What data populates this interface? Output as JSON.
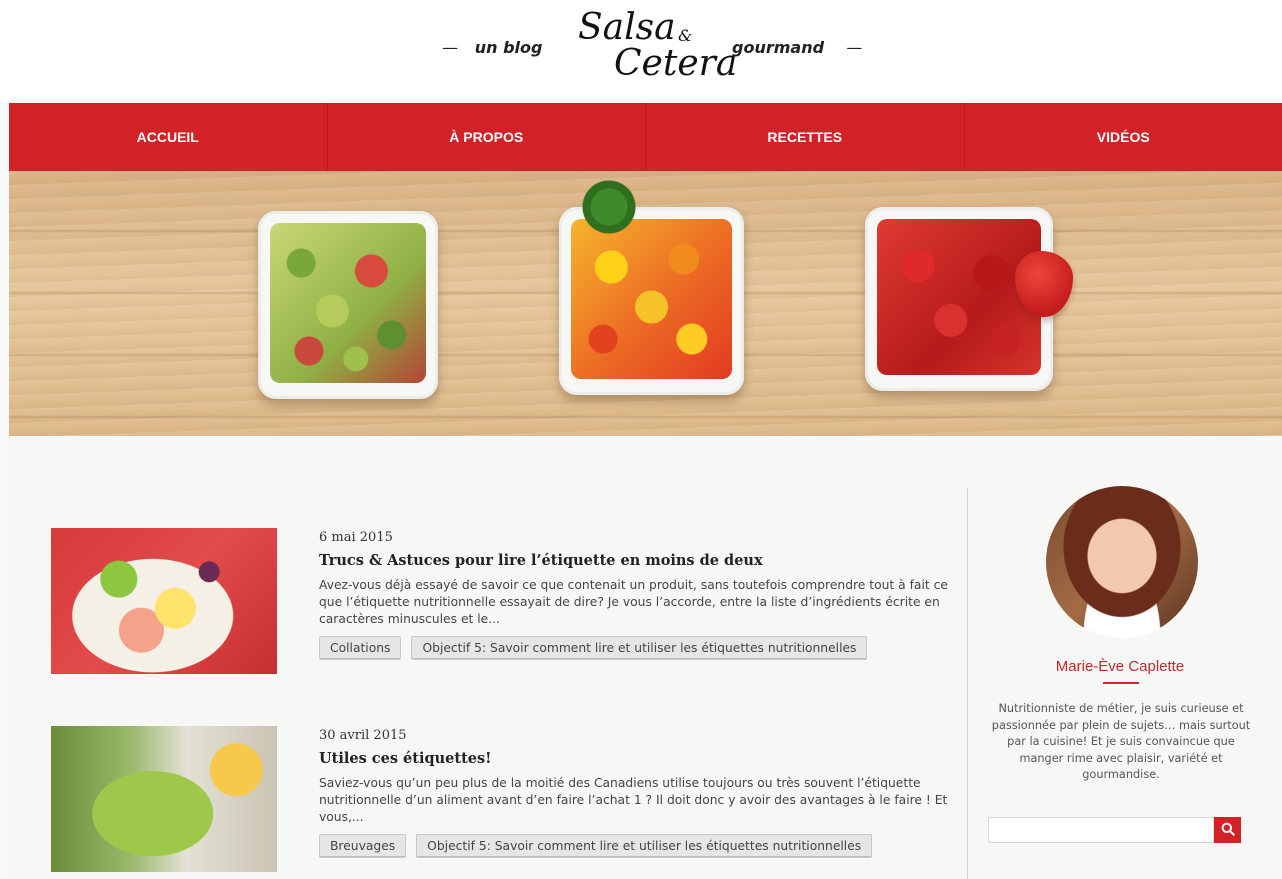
{
  "header": {
    "tagline_left": "un blog",
    "tagline_right": "gourmand",
    "dash": "—",
    "logo": {
      "word1": "Salsa",
      "amp": "&",
      "word2": "Cetera"
    }
  },
  "nav": {
    "items": [
      {
        "label": "ACCUEIL"
      },
      {
        "label": "À PROPOS"
      },
      {
        "label": "RECETTES"
      },
      {
        "label": "VIDÉOS"
      }
    ]
  },
  "posts": [
    {
      "date": "6 mai 2015",
      "title": "Trucs & Astuces pour lire l’étiquette en moins de deux",
      "excerpt": "Avez-vous déjà essayé de savoir ce que contenait un produit, sans toutefois comprendre tout à fait ce que l’étiquette nutritionnelle essayait de dire? Je vous l’accorde, entre la liste d’ingrédients écrite en caractères minuscules et le...",
      "tags": [
        "Collations",
        "Objectif 5: Savoir comment lire et utiliser les étiquettes nutritionnelles"
      ]
    },
    {
      "date": "30 avril 2015",
      "title": "Utiles ces étiquettes!",
      "excerpt": "Saviez-vous qu’un peu plus de la moitié des Canadiens utilise toujours ou très souvent l’étiquette nutritionnelle d’un aliment avant d’en faire l’achat 1 ? Il doit donc y avoir des avantages à le faire ! Et vous,...",
      "tags": [
        "Breuvages",
        "Objectif 5: Savoir comment lire et utiliser les étiquettes nutritionnelles"
      ]
    }
  ],
  "sidebar": {
    "author_name": "Marie-Ève Caplette",
    "bio": "Nutritionniste de métier, je suis curieuse et passionnée par plein de sujets… mais surtout par la cuisine! Et je suis convaincue que manger rime avec plaisir, variété et gourmandise.",
    "search": {
      "placeholder": "",
      "value": ""
    }
  },
  "colors": {
    "brand_red": "#d32227",
    "author_red": "#c8282d"
  },
  "icons": {
    "search": "search-icon"
  }
}
